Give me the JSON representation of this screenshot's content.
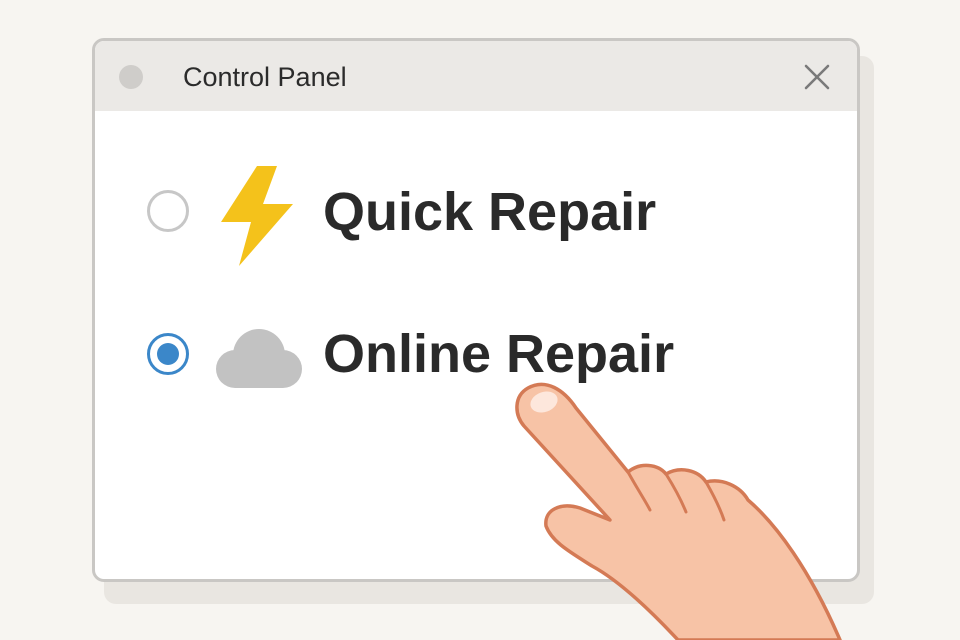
{
  "window": {
    "title": "Control Panel",
    "close_icon": "close-icon"
  },
  "options": [
    {
      "label": "Quick Repair",
      "icon": "lightning-bolt-icon",
      "selected": false
    },
    {
      "label": "Online Repair",
      "icon": "cloud-icon",
      "selected": true
    }
  ],
  "colors": {
    "accent": "#3b87c9",
    "bolt": "#f4c21b",
    "cloud": "#c2c2c2",
    "skin": "#f7c3a6",
    "skin_outline": "#d47a55"
  }
}
